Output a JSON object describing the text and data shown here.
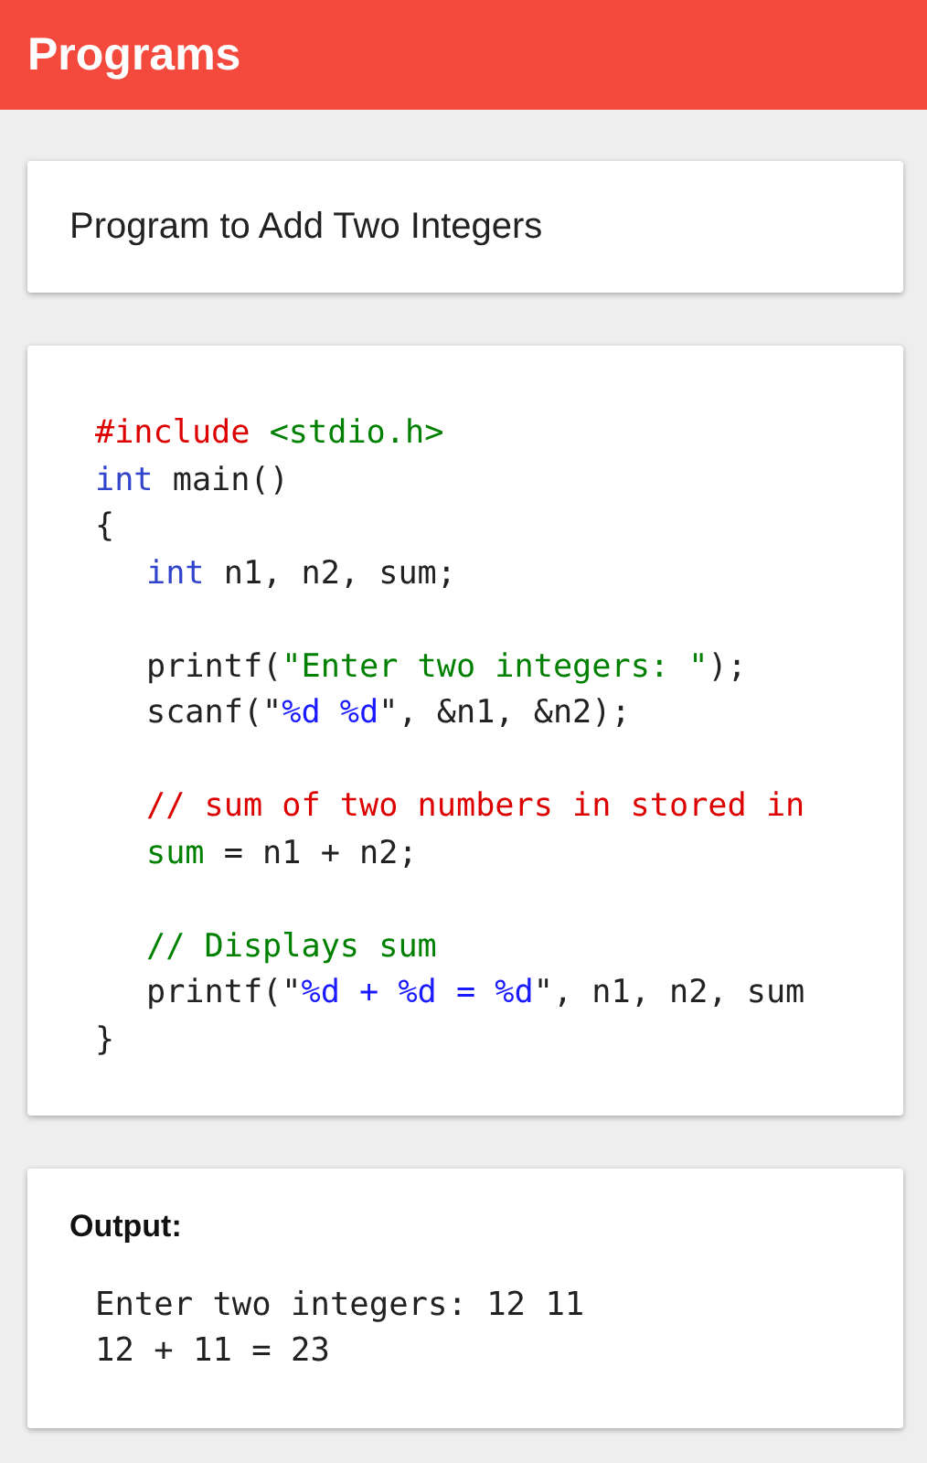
{
  "app_bar": {
    "title": "Programs"
  },
  "program_title": "Program to Add Two Integers",
  "code_lines": [
    {
      "kind": "code",
      "indent": false,
      "tokens": [
        {
          "text": "#include",
          "color": "#dd0000"
        },
        {
          "text": " <stdio.h>",
          "color": "#008000"
        }
      ]
    },
    {
      "kind": "code",
      "indent": false,
      "tokens": [
        {
          "text": "int",
          "color": "#3344cc"
        },
        {
          "text": " main()",
          "color": "#222222"
        }
      ]
    },
    {
      "kind": "code",
      "indent": false,
      "tokens": [
        {
          "text": "{",
          "color": "#222222"
        }
      ]
    },
    {
      "kind": "code",
      "indent": true,
      "tokens": [
        {
          "text": "int",
          "color": "#3344cc"
        },
        {
          "text": " n1, n2, sum;",
          "color": "#222222"
        }
      ]
    },
    {
      "kind": "blank"
    },
    {
      "kind": "code",
      "indent": true,
      "tokens": [
        {
          "text": "printf(",
          "color": "#222222"
        },
        {
          "text": "\"Enter two integers: \"",
          "color": "#008000"
        },
        {
          "text": ");",
          "color": "#222222"
        }
      ]
    },
    {
      "kind": "code",
      "indent": true,
      "tokens": [
        {
          "text": "scanf(\"",
          "color": "#222222"
        },
        {
          "text": "%d %d",
          "color": "#1a1aff"
        },
        {
          "text": "\", &n1, &n2);",
          "color": "#222222"
        }
      ]
    },
    {
      "kind": "blank"
    },
    {
      "kind": "code",
      "indent": true,
      "tokens": [
        {
          "text": "// sum of two numbers in stored in",
          "color": "#dd0000"
        }
      ]
    },
    {
      "kind": "code",
      "indent": true,
      "tokens": [
        {
          "text": "sum",
          "color": "#008000"
        },
        {
          "text": " = n1 + n2;",
          "color": "#222222"
        }
      ]
    },
    {
      "kind": "blank"
    },
    {
      "kind": "code",
      "indent": true,
      "tokens": [
        {
          "text": "// Displays sum",
          "color": "#008000"
        }
      ]
    },
    {
      "kind": "code",
      "indent": true,
      "tokens": [
        {
          "text": "printf(\"",
          "color": "#222222"
        },
        {
          "text": "%d + %d = %d",
          "color": "#1a1aff"
        },
        {
          "text": "\", n1, n2, sum",
          "color": "#222222"
        }
      ]
    },
    {
      "kind": "code",
      "indent": false,
      "tokens": [
        {
          "text": "}",
          "color": "#222222"
        }
      ]
    }
  ],
  "output": {
    "heading": "Output:",
    "lines": [
      "Enter two integers: 12 11",
      "12 + 11 = 23"
    ]
  }
}
